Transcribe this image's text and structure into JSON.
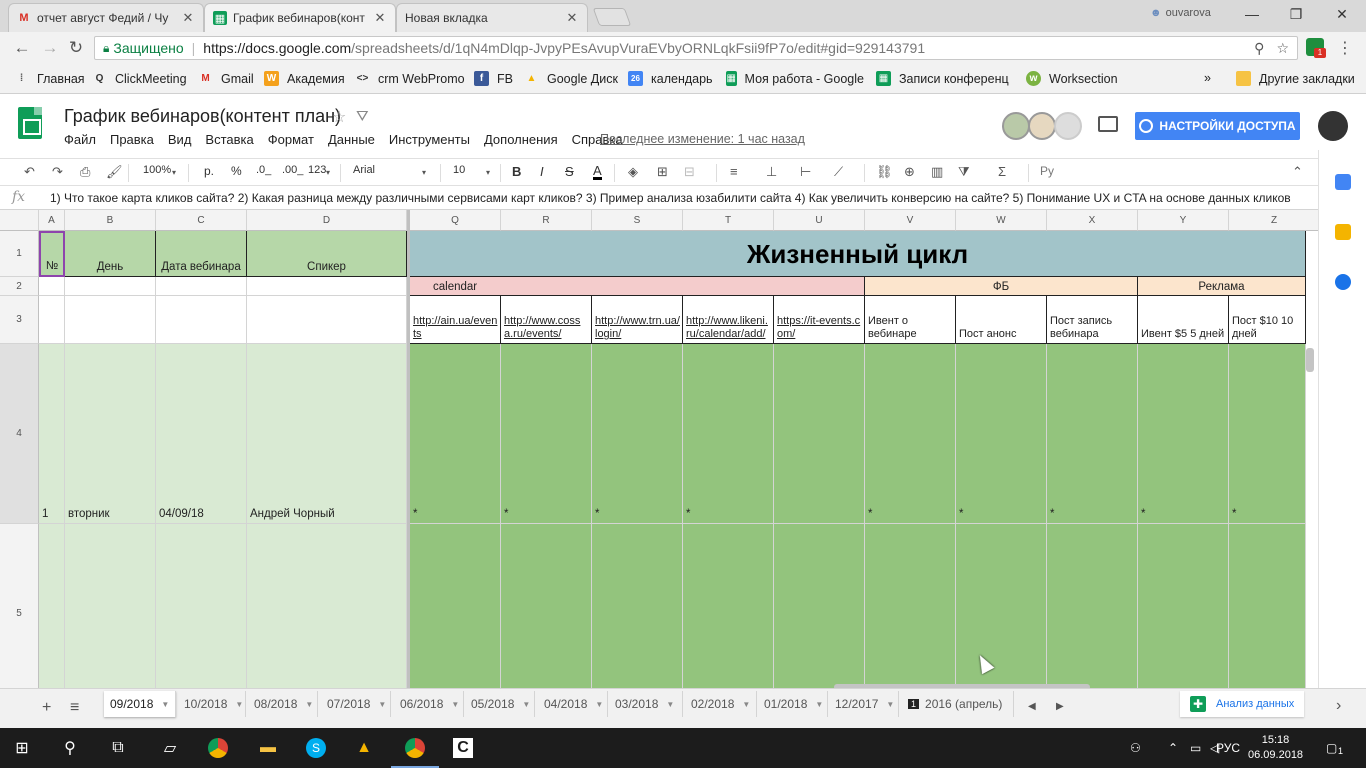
{
  "browser": {
    "tabs": [
      {
        "icon": "gmail-icon",
        "title": "отчет август Федий / Чу"
      },
      {
        "icon": "sheets-icon",
        "title": "График вебинаров(конт"
      },
      {
        "icon": "",
        "title": "Новая вкладка"
      }
    ],
    "user": "ouvarova",
    "address": {
      "secure_label": "Защищено",
      "url_host": "https://docs.google.com",
      "url_rest": "/spreadsheets/d/1qN4mDlqp-JvpyPEsAvupVuraEVbyORNLqkFsii9fP7o/edit#gid=929143791"
    },
    "extension_badge": "1",
    "bookmarks": [
      {
        "icon": "apps-icon",
        "label": "Главная"
      },
      {
        "icon": "clickmeeting-icon",
        "label": "ClickMeeting"
      },
      {
        "icon": "gmail-icon",
        "label": "Gmail"
      },
      {
        "icon": "academy-icon",
        "label": "Академия"
      },
      {
        "icon": "code-icon",
        "label": "crm WebPromo"
      },
      {
        "icon": "facebook-icon",
        "label": "FB"
      },
      {
        "icon": "drive-icon",
        "label": "Google Диск"
      },
      {
        "icon": "calendar-icon",
        "label": "календарь"
      },
      {
        "icon": "sheets-icon",
        "label": "Моя работа - Google"
      },
      {
        "icon": "sheets-icon",
        "label": "Записи конференц"
      },
      {
        "icon": "worksection-icon",
        "label": "Worksection"
      }
    ],
    "bookmarks_more": "»",
    "other_bookmarks": "Другие закладки"
  },
  "doc": {
    "title": "График вебинаров(контент план)",
    "menu": [
      "Файл",
      "Правка",
      "Вид",
      "Вставка",
      "Формат",
      "Данные",
      "Инструменты",
      "Дополнения",
      "Справка"
    ],
    "last_edit": "Последнее изменение: 1 час назад",
    "share_label": "НАСТРОЙКИ ДОСТУПА"
  },
  "toolbar": {
    "zoom": "100%",
    "currency": "р.",
    "percent": "%",
    "dec_less": ".0_",
    "dec_more": ".00_",
    "format": "123",
    "font": "Arial",
    "size": "10",
    "input_tools": "Ру"
  },
  "formula": {
    "fx": "fx",
    "content": "1) Что такое карта кликов сайта? 2) Какая разница между различными сервисами карт кликов? 3) Пример анализа юзабилити сайта 4) Как увеличить конверсию на сайте? 5) Понимание UX и CTA на основе данных кликов"
  },
  "grid": {
    "columns": [
      "A",
      "B",
      "C",
      "D",
      "Q",
      "R",
      "S",
      "T",
      "U",
      "V",
      "W",
      "X",
      "Y",
      "Z"
    ],
    "rows": [
      "1",
      "2",
      "3",
      "4",
      "5"
    ],
    "header": {
      "a": "№",
      "b": "День",
      "c": "Дата вебинара",
      "d": "Спикер"
    },
    "title": "Жизненный цикл",
    "groups": {
      "calendar": "calendar",
      "fb": "ФБ",
      "ads": "Реклама"
    },
    "row3": {
      "q": "http://ain.ua/events",
      "r": "http://www.cossa.ru/events/",
      "s": "http://www.trn.ua/login/",
      "t": "http://www.likeni.ru/calendar/add/",
      "u": "https://it-events.com/",
      "v": "Ивент о вебинаре",
      "w": "Пост анонс",
      "x": "Пост запись вебинара",
      "y": "Ивент $5 5 дней",
      "z": "Пост $10 10 дней"
    },
    "row4": {
      "a": "1",
      "b": "вторник",
      "c": "04/09/18",
      "d": "Андрей Чорный",
      "mark": "*"
    }
  },
  "sheets": {
    "add": "+",
    "list": "≡",
    "tabs": [
      "09/2018",
      "10/2018",
      "08/2018",
      "07/2018",
      "06/2018",
      "05/2018",
      "04/2018",
      "03/2018",
      "02/2018",
      "01/2018",
      "12/2017",
      "2016 (апрель)"
    ],
    "explore": "Анализ данных"
  },
  "taskbar": {
    "lang": "РУС",
    "time": "15:18",
    "date": "06.09.2018",
    "notifications": "1"
  }
}
